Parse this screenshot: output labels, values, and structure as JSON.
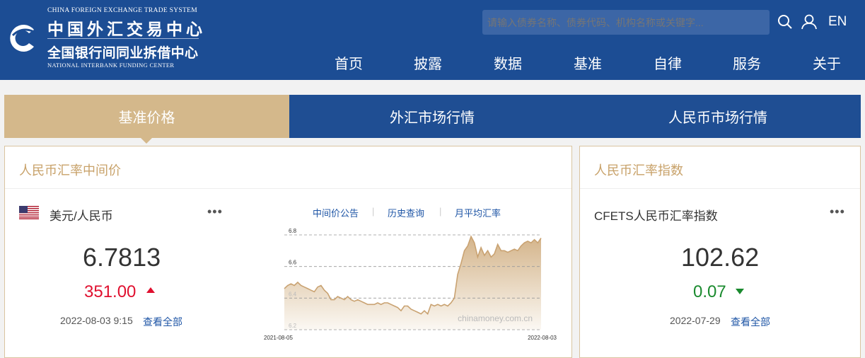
{
  "header": {
    "logo_en_top": "CHINA FOREIGN EXCHANGE TRADE SYSTEM",
    "logo_cn_top": "中国外汇交易中心",
    "logo_cn_bottom": "全国银行间同业拆借中心",
    "logo_en_bottom": "NATIONAL INTERBANK FUNDING CENTER",
    "search_placeholder": "请输入债券名称、债券代码、机构名称或关键字...",
    "lang": "EN",
    "nav": [
      "首页",
      "披露",
      "数据",
      "基准",
      "自律",
      "服务",
      "关于"
    ]
  },
  "tabs": [
    "基准价格",
    "外汇市场行情",
    "人民币市场行情"
  ],
  "left_panel": {
    "title": "人民币汇率中间价",
    "pair": "美元/人民币",
    "rate": "6.7813",
    "change": "351.00",
    "date": "2022-08-03 9:15",
    "view_all": "查看全部",
    "links": [
      "中间价公告",
      "历史查询",
      "月平均汇率"
    ],
    "watermark": "chinamoney.com.cn"
  },
  "right_panel": {
    "title": "人民币汇率指数",
    "name": "CFETS人民币汇率指数",
    "value": "102.62",
    "change": "0.07",
    "date": "2022-07-29",
    "view_all": "查看全部"
  },
  "colors": {
    "up": "#e0102f",
    "down": "#1a8a2e",
    "brand": "#1c4d94",
    "gold": "#d4b88b"
  },
  "chart_data": {
    "type": "area",
    "title": "",
    "xlabel": "",
    "ylabel": "",
    "x_start": "2021-08-05",
    "x_end": "2022-08-03",
    "x_tick_labels": [
      "2021-08-05",
      "2022-08-03"
    ],
    "ylim": [
      6.2,
      6.8
    ],
    "y_ticks": [
      "6.2",
      "6.4",
      "6.6",
      "6.8"
    ],
    "grid": true,
    "values": [
      6.46,
      6.48,
      6.49,
      6.48,
      6.5,
      6.48,
      6.47,
      6.46,
      6.45,
      6.44,
      6.47,
      6.48,
      6.45,
      6.43,
      6.39,
      6.39,
      6.41,
      6.4,
      6.39,
      6.41,
      6.39,
      6.38,
      6.39,
      6.38,
      6.37,
      6.36,
      6.36,
      6.36,
      6.37,
      6.36,
      6.37,
      6.37,
      6.36,
      6.35,
      6.34,
      6.32,
      6.35,
      6.35,
      6.33,
      6.32,
      6.31,
      6.3,
      6.32,
      6.3,
      6.36,
      6.35,
      6.36,
      6.35,
      6.36,
      6.35,
      6.37,
      6.4,
      6.55,
      6.62,
      6.7,
      6.73,
      6.79,
      6.75,
      6.66,
      6.72,
      6.67,
      6.7,
      6.66,
      6.68,
      6.74,
      6.7,
      6.7,
      6.69,
      6.7,
      6.71,
      6.7,
      6.73,
      6.75,
      6.76,
      6.75,
      6.77,
      6.75,
      6.78
    ]
  }
}
